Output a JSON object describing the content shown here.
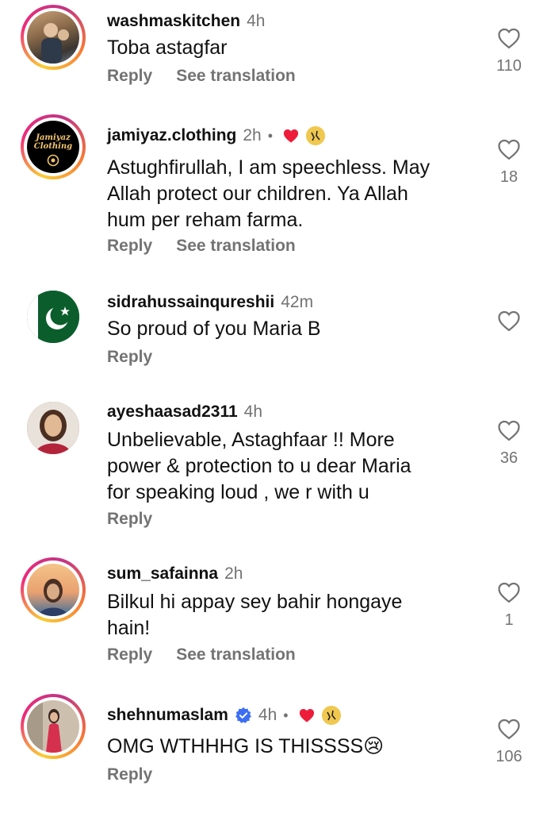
{
  "comments": [
    {
      "username": "washmaskitchen",
      "time": "4h",
      "text_lines": [
        "Toba astagfar"
      ],
      "reply_label": "Reply",
      "see_translation_label": "See translation",
      "likes": "110"
    },
    {
      "username": "jamiyaz.clothing",
      "time": "2h",
      "separator": "•",
      "avatar_text": [
        "Jamiyaz",
        "Clothing"
      ],
      "text_lines": [
        "Astughfirullah, I am speechless. May",
        "Allah protect our children. Ya Allah",
        "hum per reham farma."
      ],
      "reply_label": "Reply",
      "see_translation_label": "See translation",
      "likes": "18"
    },
    {
      "username": "sidrahussainqureshii",
      "time": "42m",
      "text_lines": [
        "So proud of you Maria B"
      ],
      "reply_label": "Reply",
      "likes": ""
    },
    {
      "username": "ayeshaasad2311",
      "time": "4h",
      "text_lines": [
        "Unbelievable, Astaghfaar !! More",
        "power & protection to u dear Maria",
        "for speaking loud , we r with u"
      ],
      "reply_label": "Reply",
      "likes": "36"
    },
    {
      "username": "sum_safainna",
      "time": "2h",
      "text_lines": [
        "Bilkul hi appay sey bahir hongaye",
        "hain!"
      ],
      "reply_label": "Reply",
      "see_translation_label": "See translation",
      "likes": "1"
    },
    {
      "username": "shehnumaslam",
      "time": "4h",
      "separator": "•",
      "text_lines": [
        "OMG WTHHHG IS THISSSS😢"
      ],
      "reply_label": "Reply",
      "likes": "106"
    }
  ],
  "colors": {
    "secondary_text": "#737373",
    "primary_text": "#111111",
    "heart_red": "#ed1c3b",
    "verified_blue": "#3b6ef2"
  }
}
